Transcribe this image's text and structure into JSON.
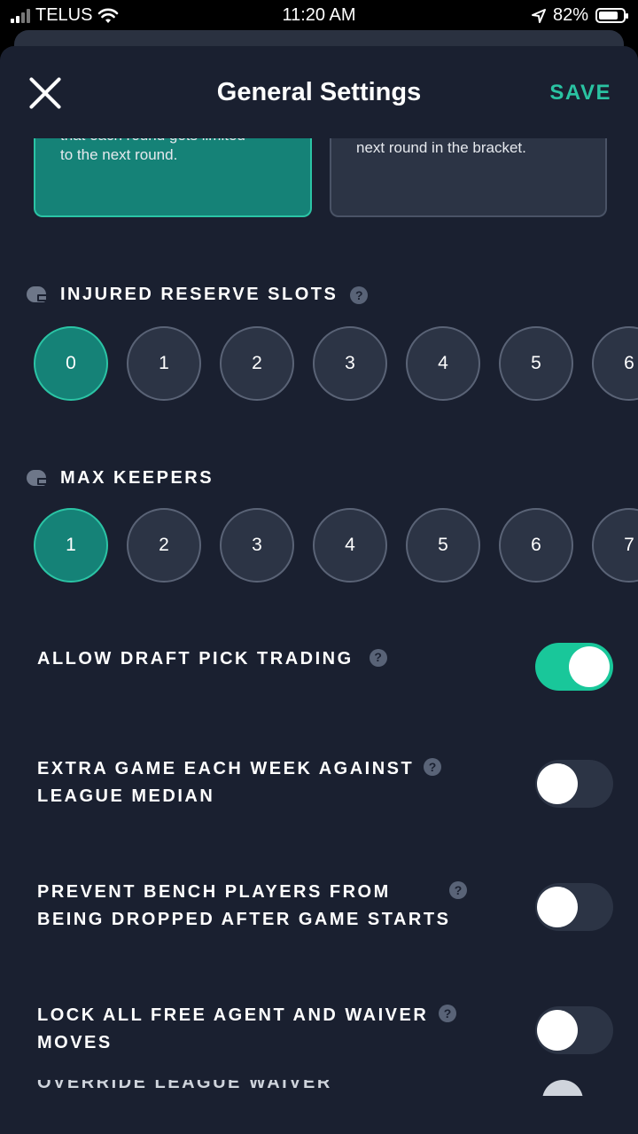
{
  "status_bar": {
    "carrier": "TELUS",
    "time": "11:20 AM",
    "battery": "82%",
    "battery_level": 0.82
  },
  "header": {
    "title": "General Settings",
    "save_label": "SAVE"
  },
  "cards": {
    "left_partial": "that each round gets limited",
    "left_text": "to the next round.",
    "right_text": "next round in the bracket."
  },
  "injured_reserve": {
    "label": "INJURED RESERVE SLOTS",
    "options": [
      "0",
      "1",
      "2",
      "3",
      "4",
      "5",
      "6"
    ],
    "selected": "0"
  },
  "max_keepers": {
    "label": "MAX KEEPERS",
    "options": [
      "1",
      "2",
      "3",
      "4",
      "5",
      "6",
      "7"
    ],
    "selected": "1"
  },
  "toggles": {
    "draft_pick_trading": {
      "line1": "ALLOW DRAFT PICK TRADING",
      "on": true
    },
    "league_median": {
      "line1": "EXTRA GAME EACH WEEK AGAINST",
      "line2": "LEAGUE MEDIAN",
      "on": false
    },
    "prevent_bench": {
      "line1": "PREVENT BENCH PLAYERS FROM",
      "line2": "BEING DROPPED AFTER GAME STARTS",
      "on": false
    },
    "lock_moves": {
      "line1": "LOCK ALL FREE AGENT AND WAIVER",
      "line2": "MOVES",
      "on": false
    }
  },
  "bottom_partial_label": "OVERRIDE LEAGUE WAIVER CAPACITY",
  "help_glyph": "?"
}
